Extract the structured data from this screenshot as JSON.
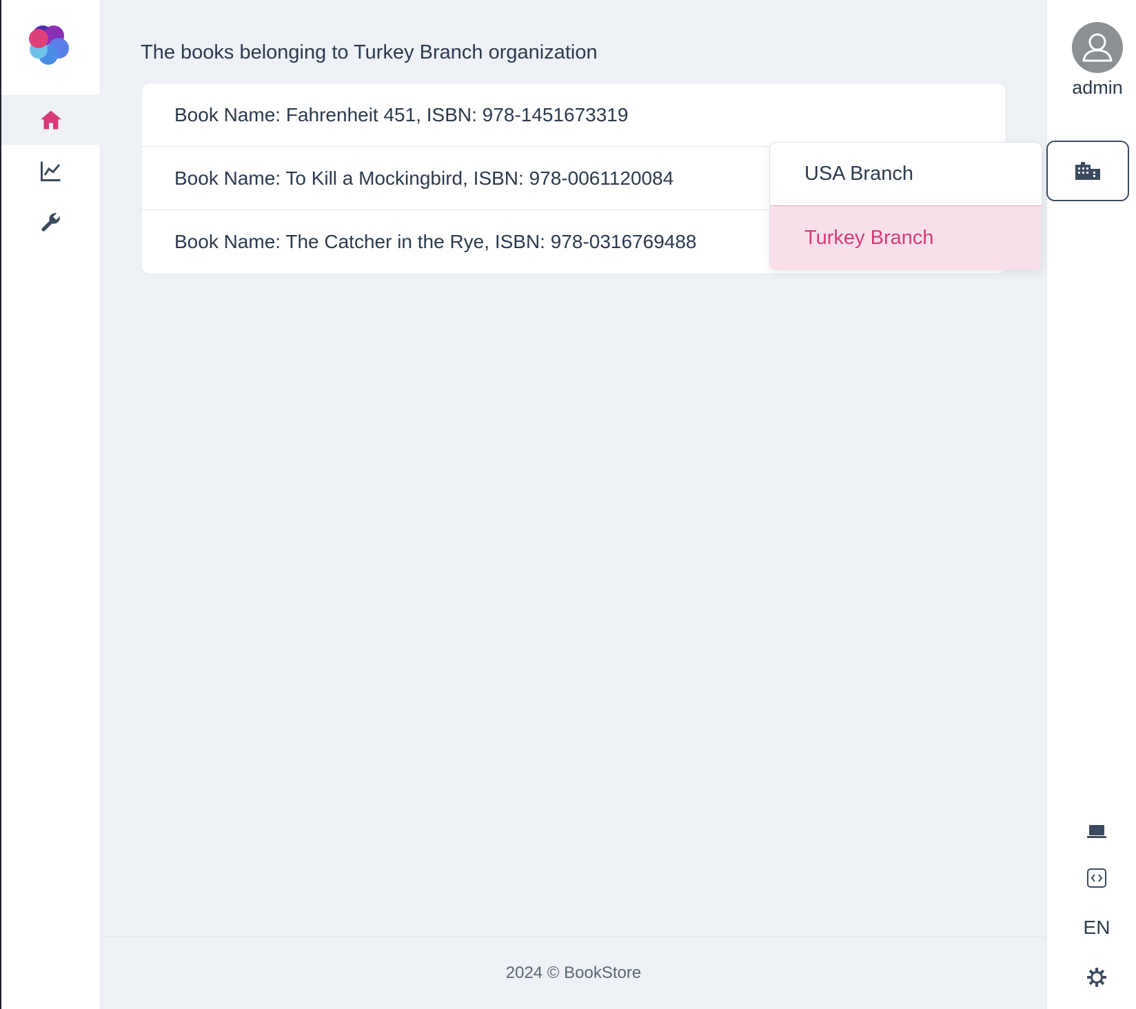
{
  "page": {
    "title": "The books belonging to Turkey Branch organization"
  },
  "books": [
    "Book Name: Fahrenheit 451, ISBN: 978-1451673319",
    "Book Name: To Kill a Mockingbird, ISBN: 978-0061120084",
    "Book Name: The Catcher in the Rye, ISBN: 978-0316769488"
  ],
  "sidebar": {
    "items": [
      {
        "name": "home",
        "icon": "home-icon",
        "active": true
      },
      {
        "name": "dashboard",
        "icon": "chart-line-icon",
        "active": false
      },
      {
        "name": "administration",
        "icon": "wrench-icon",
        "active": false
      }
    ]
  },
  "user": {
    "name": "admin"
  },
  "organization_menu": {
    "options": [
      "USA Branch",
      "Turkey Branch"
    ],
    "selected": "Turkey Branch"
  },
  "rightbar": {
    "language": "EN"
  },
  "footer": {
    "text": "2024 © BookStore"
  },
  "colors": {
    "accent": "#d63a79",
    "text": "#2b3a4f",
    "background": "#eef1f5"
  }
}
